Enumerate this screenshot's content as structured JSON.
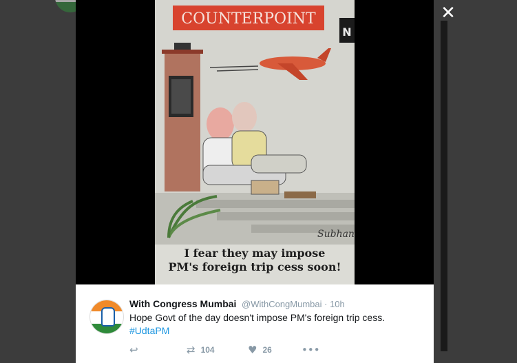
{
  "comic": {
    "title": "COUNTERPOINT",
    "caption_line1": "I fear they may impose",
    "caption_line2": "PM's foreign trip cess soon!",
    "signature": "Subhani"
  },
  "tweet": {
    "author_name": "With Congress Mumbai",
    "handle": "@WithCongMumbai",
    "separator": " · ",
    "time": "10h",
    "text": "Hope Govt of the day doesn't impose PM's foreign trip cess.",
    "hashtag": "#UdtaPM",
    "retweets": "104",
    "likes": "26"
  },
  "icons": {
    "close": "close-icon",
    "reply": "reply-icon",
    "retweet": "retweet-icon",
    "like": "heart-icon",
    "more": "more-icon"
  },
  "colors": {
    "backdrop": "#3c3c3c",
    "link": "#1b95e0",
    "muted": "#8899a6",
    "title_band": "#d8432e"
  }
}
